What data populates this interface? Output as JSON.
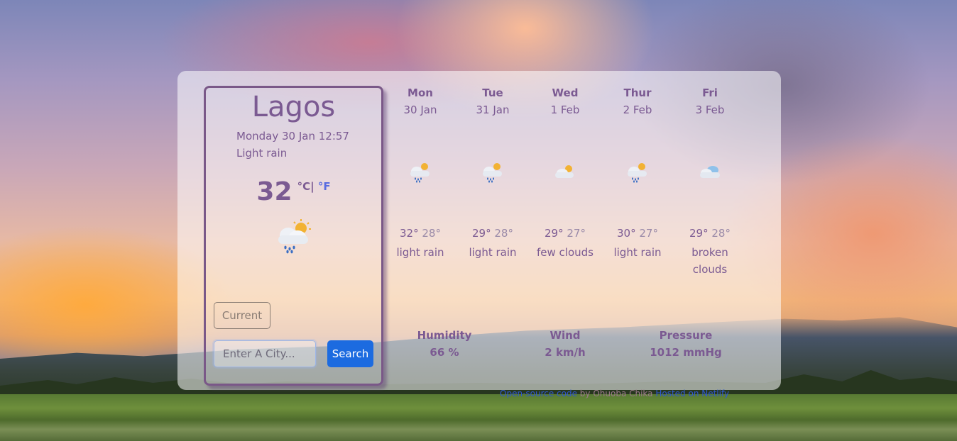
{
  "current": {
    "city": "Lagos",
    "datetime": "Monday 30 Jan 12:57",
    "description": "Light rain",
    "temperature": "32",
    "unit_c": "°C",
    "unit_sep": "|",
    "unit_f": "°F",
    "icon": "rain-sun-icon"
  },
  "controls": {
    "current_label": "Current",
    "search_placeholder": "Enter A City...",
    "search_label": "Search"
  },
  "forecast": [
    {
      "day": "Mon",
      "date": "30 Jan",
      "max": "32°",
      "min": "28°",
      "description": "light rain",
      "icon": "rain-sun-icon"
    },
    {
      "day": "Tue",
      "date": "31 Jan",
      "max": "29°",
      "min": "28°",
      "description": "light rain",
      "icon": "rain-sun-icon"
    },
    {
      "day": "Wed",
      "date": "1 Feb",
      "max": "29°",
      "min": "27°",
      "description": "few clouds",
      "icon": "sun-cloud-icon"
    },
    {
      "day": "Thur",
      "date": "2 Feb",
      "max": "30°",
      "min": "27°",
      "description": "light rain",
      "icon": "rain-sun-icon"
    },
    {
      "day": "Fri",
      "date": "3 Feb",
      "max": "29°",
      "min": "28°",
      "description": "broken clouds",
      "icon": "broken-clouds-icon"
    }
  ],
  "stats": {
    "humidity_label": "Humidity",
    "humidity_value": "66 %",
    "wind_label": "Wind",
    "wind_value": "2 km/h",
    "pressure_label": "Pressure",
    "pressure_value": "1012 mmHg"
  },
  "footer": {
    "source_link": "Open-source code",
    "by_text": " by Ohuoba Chika ",
    "host_link": "Hosted on Netlify"
  },
  "colors": {
    "accent": "#7b5a92",
    "search_button": "#1c6be0",
    "unit_link": "#5a6de0",
    "footer_link": "#2f59d0"
  }
}
